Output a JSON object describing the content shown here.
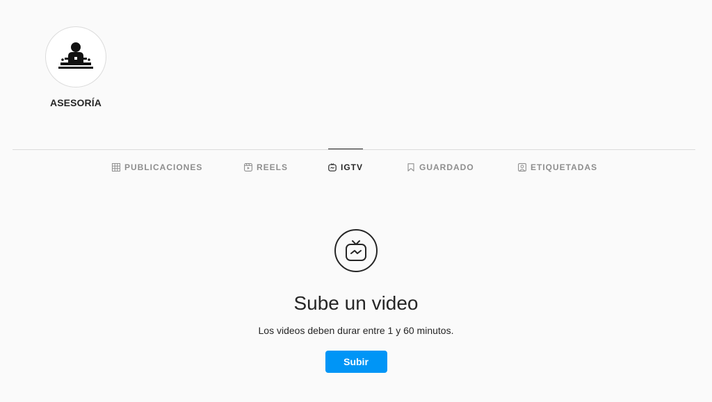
{
  "highlight": {
    "label": "ASESORÍA",
    "icon": "reception-desk-icon"
  },
  "tabs": [
    {
      "label": "PUBLICACIONES",
      "icon": "grid-icon",
      "active": false
    },
    {
      "label": "REELS",
      "icon": "reels-icon",
      "active": false
    },
    {
      "label": "IGTV",
      "icon": "igtv-icon",
      "active": true
    },
    {
      "label": "GUARDADO",
      "icon": "bookmark-icon",
      "active": false
    },
    {
      "label": "ETIQUETADAS",
      "icon": "tagged-icon",
      "active": false
    }
  ],
  "empty_state": {
    "icon": "igtv-icon",
    "title": "Sube un video",
    "subtitle": "Los videos deben durar entre 1 y 60 minutos.",
    "button_label": "Subir"
  },
  "colors": {
    "background": "#fafafa",
    "text": "#262626",
    "muted": "#8e8e8e",
    "border": "#dbdbdb",
    "accent": "#0095f6"
  }
}
